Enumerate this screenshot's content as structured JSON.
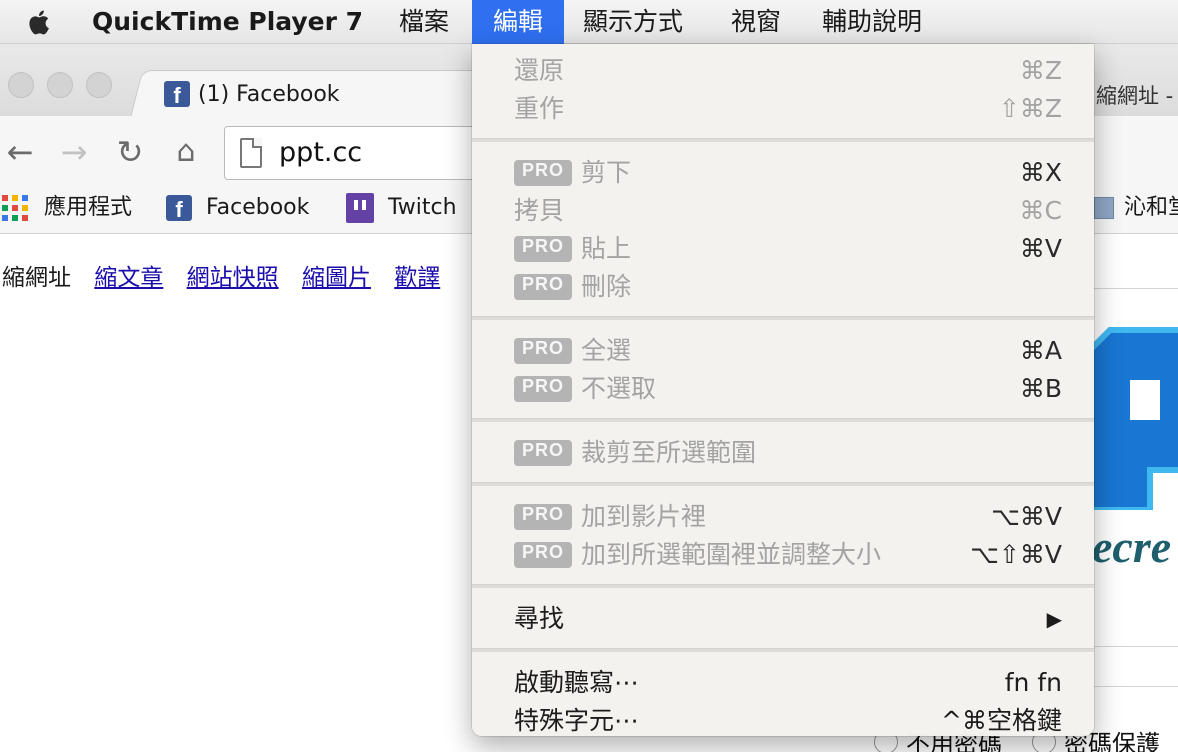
{
  "menubar": {
    "app_name": "QuickTime Player 7",
    "items": [
      "檔案",
      "編輯",
      "顯示方式",
      "視窗",
      "輔助說明"
    ],
    "active_index": 1
  },
  "browser": {
    "tab_title": "(1) Facebook",
    "tab_right_partial": "縮網址 - 不",
    "url": "ppt.cc",
    "bookmarks": [
      "應用程式",
      "Facebook",
      "Twitch",
      "沁和堂"
    ]
  },
  "page": {
    "nav_current": "縮網址",
    "nav_links": [
      "縮文章",
      "網站快照",
      "縮圖片",
      "歡譯"
    ],
    "logo_partial": "ecre",
    "radio_options": [
      "不用密碼",
      "密碼保護"
    ]
  },
  "edit_menu": {
    "pro_badge": "PRO",
    "groups": [
      [
        {
          "label": "還原",
          "shortcut": "⌘Z",
          "pro": false,
          "state": "disabled"
        },
        {
          "label": "重作",
          "shortcut": "⇧⌘Z",
          "pro": false,
          "state": "disabled"
        }
      ],
      [
        {
          "label": "剪下",
          "shortcut": "⌘X",
          "pro": true,
          "state": "pro"
        },
        {
          "label": "拷貝",
          "shortcut": "⌘C",
          "pro": false,
          "state": "disabled"
        },
        {
          "label": "貼上",
          "shortcut": "⌘V",
          "pro": true,
          "state": "pro"
        },
        {
          "label": "刪除",
          "shortcut": "",
          "pro": true,
          "state": "pro"
        }
      ],
      [
        {
          "label": "全選",
          "shortcut": "⌘A",
          "pro": true,
          "state": "pro"
        },
        {
          "label": "不選取",
          "shortcut": "⌘B",
          "pro": true,
          "state": "pro"
        }
      ],
      [
        {
          "label": "裁剪至所選範圍",
          "shortcut": "",
          "pro": true,
          "state": "pro"
        }
      ],
      [
        {
          "label": "加到影片裡",
          "shortcut": "⌥⌘V",
          "pro": true,
          "state": "pro"
        },
        {
          "label": "加到所選範圍裡並調整大小",
          "shortcut": "⌥⇧⌘V",
          "pro": true,
          "state": "pro"
        }
      ],
      [
        {
          "label": "尋找",
          "shortcut": "▶",
          "pro": false,
          "state": "enabled"
        }
      ],
      [
        {
          "label": "啟動聽寫⋯",
          "shortcut": "fn fn",
          "pro": false,
          "state": "enabled"
        },
        {
          "label": "特殊字元⋯",
          "shortcut": "^⌘空格鍵",
          "pro": false,
          "state": "enabled"
        }
      ]
    ]
  }
}
